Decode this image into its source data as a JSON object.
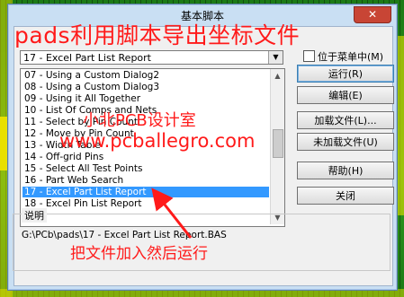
{
  "dialog": {
    "title": "基本脚本",
    "close_glyph": "✕"
  },
  "script_combo": {
    "value": "17 - Excel Part List Report",
    "arrow_glyph": "▼"
  },
  "menu_checkbox": {
    "label": "位于菜单中(M)",
    "checked": false
  },
  "script_list": {
    "items": [
      "07 - Using a Custom Dialog2",
      "08 - Using a Custom Dialog3",
      "09 - Using it All Together",
      "10 - List Of Comps and Nets",
      "11 - Select by Pin Count",
      "12 - Move by Pin Count",
      "13 - Width Table",
      "14 - Off-grid Pins",
      "15 - Select All Test Points",
      "16 - Part Web Search",
      "17 - Excel Part List Report",
      "18 - Excel Pin List Report"
    ],
    "selected_index": 10
  },
  "buttons": {
    "run": "运行(R)",
    "edit": "编辑(E)",
    "load": "加载文件(L)...",
    "unload": "未加载文件(U)",
    "help": "帮助(H)",
    "close": "关闭"
  },
  "description": {
    "title": "说明",
    "text": "G:\\PCb\\pads\\17 - Excel Part List Report.BAS"
  },
  "overlay": {
    "title": "pads利用脚本导出坐标文件",
    "mid": "小北PCB设计室",
    "url": "www.pcballegro.com",
    "bottom": "把文件加入然后运行",
    "color": "#ff1a1a"
  }
}
